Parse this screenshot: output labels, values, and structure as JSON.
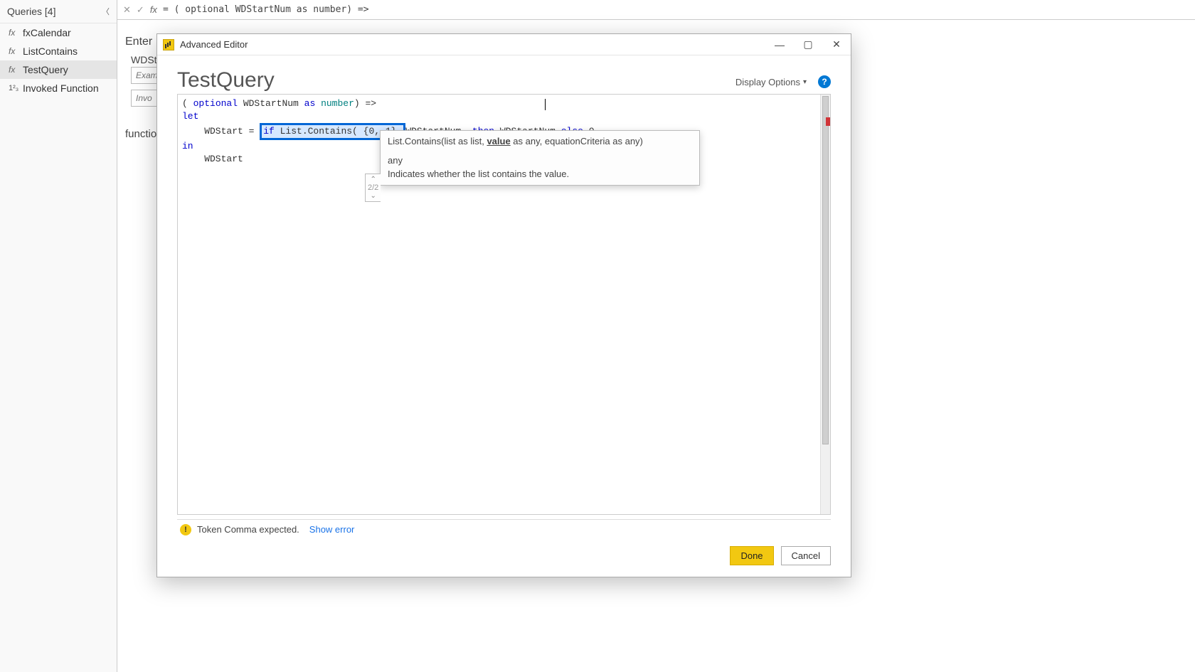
{
  "sidebar": {
    "header": "Queries [4]",
    "items": [
      {
        "icon": "fx",
        "label": "fxCalendar"
      },
      {
        "icon": "fx",
        "label": "ListContains"
      },
      {
        "icon": "fx",
        "label": "TestQuery"
      },
      {
        "icon": "123",
        "label": "Invoked Function"
      }
    ],
    "selected_index": 2
  },
  "formula_bar": {
    "discard_glyph": "✕",
    "commit_glyph": "✓",
    "fx_label": "fx",
    "code": "= ( optional WDStartNum as number) =>"
  },
  "bg_panel": {
    "enter_label": "Enter",
    "param_name": "WDSt",
    "param_placeholder": "Exam",
    "invoke_placeholder": "Invo",
    "function_label": "functio"
  },
  "dialog": {
    "title": "Advanced Editor",
    "query_name": "TestQuery",
    "display_options": "Display Options",
    "help_glyph": "?",
    "win": {
      "min": "—",
      "max": "▢",
      "close": "✕"
    },
    "code": {
      "line1_a": "( ",
      "line1_opt": "optional",
      "line1_b": " WDStartNum ",
      "line1_as": "as",
      "line1_c": " ",
      "line1_num": "number",
      "line1_d": ") =>",
      "line2_let": "let",
      "line3_indent": "    WDStart = ",
      "line3_box": "if List.Contains( {0, 1},",
      "line3_after1": "WDStartNum  ",
      "line3_then": "then",
      "line3_after2": " WDStartNum ",
      "line3_else": "else",
      "line3_after3": " 0",
      "line4_in": "in",
      "line5": "    WDStart"
    },
    "tooltip": {
      "sig_prefix": "List.Contains(list as list, ",
      "sig_param": "value",
      "sig_suffix": " as any, equationCriteria as any)",
      "return_type": "any",
      "description": "Indicates whether the list contains the value.",
      "nav_up": "⌃",
      "nav_count": "2/2",
      "nav_down": "⌄"
    },
    "error": {
      "message": "Token Comma expected.",
      "link": "Show error",
      "warn_glyph": "!"
    },
    "buttons": {
      "done": "Done",
      "cancel": "Cancel"
    }
  }
}
